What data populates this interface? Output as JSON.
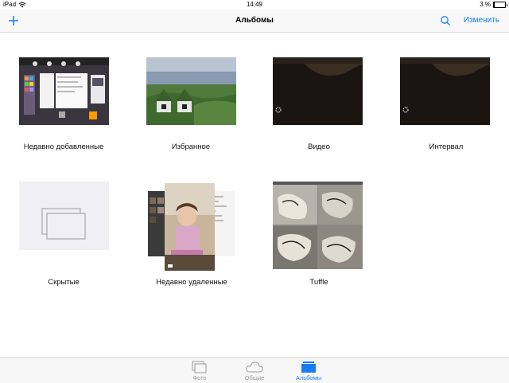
{
  "status_bar": {
    "device": "iPad",
    "time": "14:49",
    "battery_text": "3 %",
    "battery_level": 0.03
  },
  "nav": {
    "title": "Альбомы",
    "edit_label": "Изменить",
    "add_icon": "plus-icon",
    "search_icon": "search-icon",
    "accent": "#1a7cf5"
  },
  "albums": [
    {
      "label": "Недавно добавленные"
    },
    {
      "label": "Избранное"
    },
    {
      "label": "Видео"
    },
    {
      "label": "Интервал"
    },
    {
      "label": "Скрытые"
    },
    {
      "label": "Недавно удаленные"
    },
    {
      "label": "Tuffle"
    }
  ],
  "tabs": [
    {
      "label": "Фото",
      "icon": "photos-icon",
      "active": false
    },
    {
      "label": "Общие",
      "icon": "cloud-icon",
      "active": false
    },
    {
      "label": "Альбомы",
      "icon": "albums-icon",
      "active": true
    }
  ]
}
